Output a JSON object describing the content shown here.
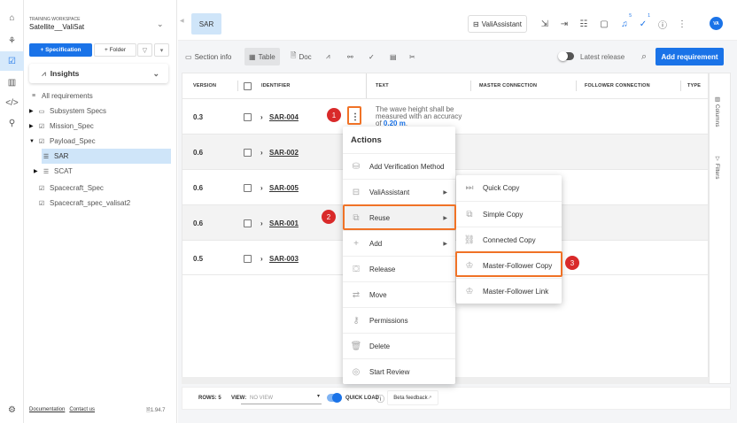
{
  "sidebar": {
    "workspace_label": "TRAINING WORKSPACE",
    "workspace_name": "Satellite__ValiSat",
    "spec_button": "+ Specification",
    "folder_button": "+ Folder",
    "insights": "Insights",
    "tree": [
      {
        "label": "All requirements",
        "icon": "list-icon"
      },
      {
        "label": "Subsystem Specs",
        "icon": "folder-icon"
      },
      {
        "label": "Mission_Spec",
        "icon": "spec-icon"
      },
      {
        "label": "Payload_Spec",
        "icon": "spec-icon"
      },
      {
        "label": "SAR",
        "icon": "doc-list-icon"
      },
      {
        "label": "SCAT",
        "icon": "doc-list-icon"
      },
      {
        "label": "Spacecraft_Spec",
        "icon": "spec-icon"
      },
      {
        "label": "Spacecraft_spec_valisat2",
        "icon": "spec-icon"
      }
    ],
    "documentation": "Documentation",
    "contact": "Contact us",
    "version": "1.94.7"
  },
  "header": {
    "tab": "SAR",
    "valiassistant": "ValiAssistant",
    "notif_count": "5",
    "check_count": "1",
    "avatar": "VA"
  },
  "toolbar": {
    "section_info": "Section info",
    "table": "Table",
    "doc": "Doc",
    "latest_release": "Latest release",
    "add_requirement": "Add requirement"
  },
  "table": {
    "columns": [
      "VERSION",
      "IDENTIFIER",
      "TEXT",
      "MASTER CONNECTION",
      "FOLLOWER CONNECTION",
      "TYPE"
    ],
    "rows": [
      {
        "version": "0.3",
        "id": "SAR-004",
        "text_pre": "The wave height shall be measured with an accuracy of ",
        "text_val": "0.20 m",
        "text_post": "."
      },
      {
        "version": "0.6",
        "id": "SAR-002"
      },
      {
        "version": "0.6",
        "id": "SAR-005"
      },
      {
        "version": "0.6",
        "id": "SAR-001"
      },
      {
        "version": "0.5",
        "id": "SAR-003"
      }
    ],
    "side_columns": "Columns",
    "side_filters": "Filters"
  },
  "footer": {
    "rows": "ROWS: 5",
    "view_label": "VIEW:",
    "view_value": "NO VIEW",
    "quick_load": "QUICK LOAD",
    "beta": "Beta feedback"
  },
  "actions_menu": {
    "title": "Actions",
    "items": [
      "Add Verification Method",
      "ValiAssistant",
      "Reuse",
      "Add",
      "Release",
      "Move",
      "Permissions",
      "Delete",
      "Start Review"
    ]
  },
  "reuse_menu": {
    "items": [
      "Quick Copy",
      "Simple Copy",
      "Connected Copy",
      "Master-Follower Copy",
      "Master-Follower Link"
    ]
  },
  "steps": [
    "1",
    "2",
    "3"
  ],
  "colors": {
    "accent": "#1a73e8",
    "highlight": "#f07226",
    "step_badge": "#d92a2a"
  }
}
